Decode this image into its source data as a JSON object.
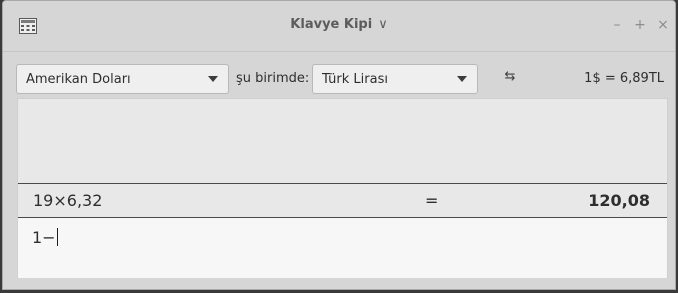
{
  "window": {
    "title": "Klavye Kipi",
    "title_caret": "∨",
    "controls": {
      "minimize": "–",
      "maximize": "+",
      "close": "×"
    },
    "app_icon": "calculator-icon"
  },
  "toolbar": {
    "from_currency": "Amerikan Doları",
    "in_label": "şu birimde:",
    "to_currency": "Türk Lirası",
    "swap_icon": "swap-arrows-icon",
    "swap_glyph": "⇆",
    "rate_text": "1$ = 6,89TL"
  },
  "history": [
    {
      "expression": "19×6,32",
      "equals": "=",
      "result": "120,08"
    }
  ],
  "input": {
    "value": "1−"
  }
}
